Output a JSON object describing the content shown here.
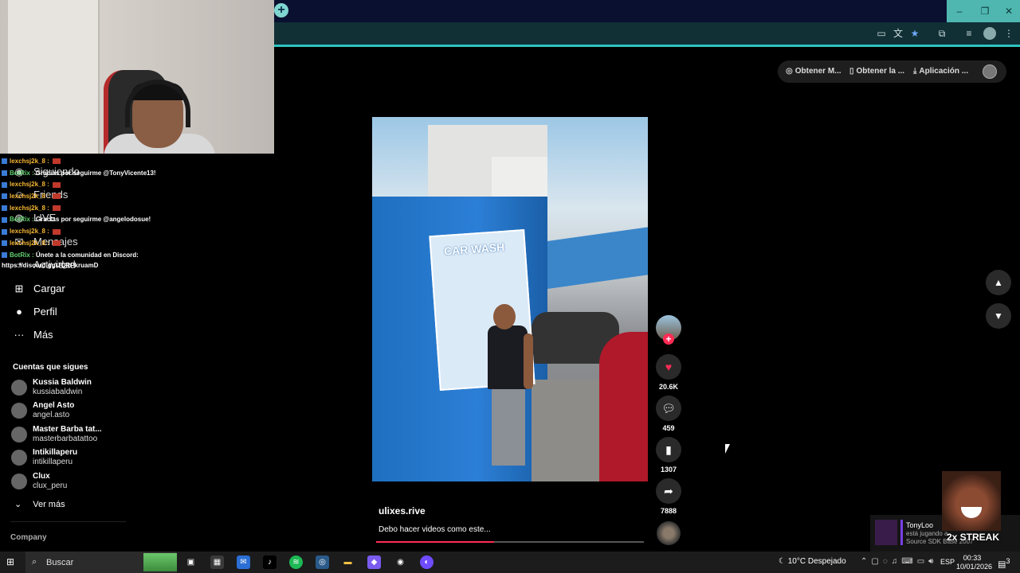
{
  "browser": {
    "newtab_icon": "+",
    "window_controls": [
      "–",
      "❐",
      "✕"
    ],
    "toolbar_icons": [
      "screen-cast-icon",
      "translate-icon",
      "star-icon",
      "extensions-icon",
      "media-icon",
      "profile-avatar",
      "menu-icon"
    ]
  },
  "top_actions": {
    "item1": "Obtener M...",
    "item2": "Obtener la ...",
    "item3": "Aplicación ..."
  },
  "chat": {
    "lines": [
      {
        "user": "lexchsj2k_8 :",
        "msg": ""
      },
      {
        "user": "BotRix :",
        "msg": "Gracias por seguirme @TonyVicente13!"
      },
      {
        "user": "lexchsj2k_8 :",
        "msg": ""
      },
      {
        "user": "lexchsj2k_8 :",
        "msg": ""
      },
      {
        "user": "lexchsj2k_8 :",
        "msg": ""
      },
      {
        "user": "BotRix :",
        "msg": "Gracias por seguirme @angelodosue!"
      },
      {
        "user": "lexchsj2k_8 :",
        "msg": ""
      },
      {
        "user": "lexchsj2k_8 :",
        "msg": ""
      },
      {
        "user": "BotRix :",
        "msg": "Únete a la comunidad en Discord:"
      }
    ],
    "link": "https://discord.gg/JQRPkruamD"
  },
  "sidebar": {
    "items": [
      {
        "label": "Siguiendo",
        "icon": "following-icon"
      },
      {
        "label": "Friends",
        "icon": "friends-icon"
      },
      {
        "label": "LIVE",
        "icon": "live-icon"
      },
      {
        "label": "Mensajes",
        "icon": "messages-icon"
      },
      {
        "label": "Actividad",
        "icon": "activity-icon"
      },
      {
        "label": "Cargar",
        "icon": "upload-icon"
      },
      {
        "label": "Perfil",
        "icon": "profile-icon"
      },
      {
        "label": "Más",
        "icon": "more-icon"
      }
    ],
    "following_title": "Cuentas que sigues",
    "accounts": [
      {
        "name": "Kussia Baldwin",
        "handle": "kussiabaldwin"
      },
      {
        "name": "Angel Asto",
        "handle": "angel.asto"
      },
      {
        "name": "Master Barba tat...",
        "handle": "masterbarbatattoo"
      },
      {
        "name": "Intikillaperu",
        "handle": "intikillaperu"
      },
      {
        "name": "Clux",
        "handle": "clux_peru"
      }
    ],
    "see_more": "Ver más",
    "company": "Company"
  },
  "video": {
    "sign_text": "CAR WASH",
    "author": "ulixes.rive",
    "description": "Debo hacer videos como este...",
    "progress": 0.44
  },
  "actions": {
    "likes": "20.6K",
    "comments": "459",
    "saves": "1307",
    "shares": "7888"
  },
  "streak": {
    "label": "2x STREAK",
    "user": "TonyLoo",
    "status": "está jugando a...",
    "source": "Source SDK Base 2007"
  },
  "taskbar": {
    "search_placeholder": "Buscar",
    "weather": "10°C  Despejado",
    "lang": "ESP",
    "time": "00:33",
    "date": "10/01/2026",
    "notif_count": "3"
  },
  "colors": {
    "accent": "#fe2c55",
    "teal": "#2ec4c0"
  }
}
